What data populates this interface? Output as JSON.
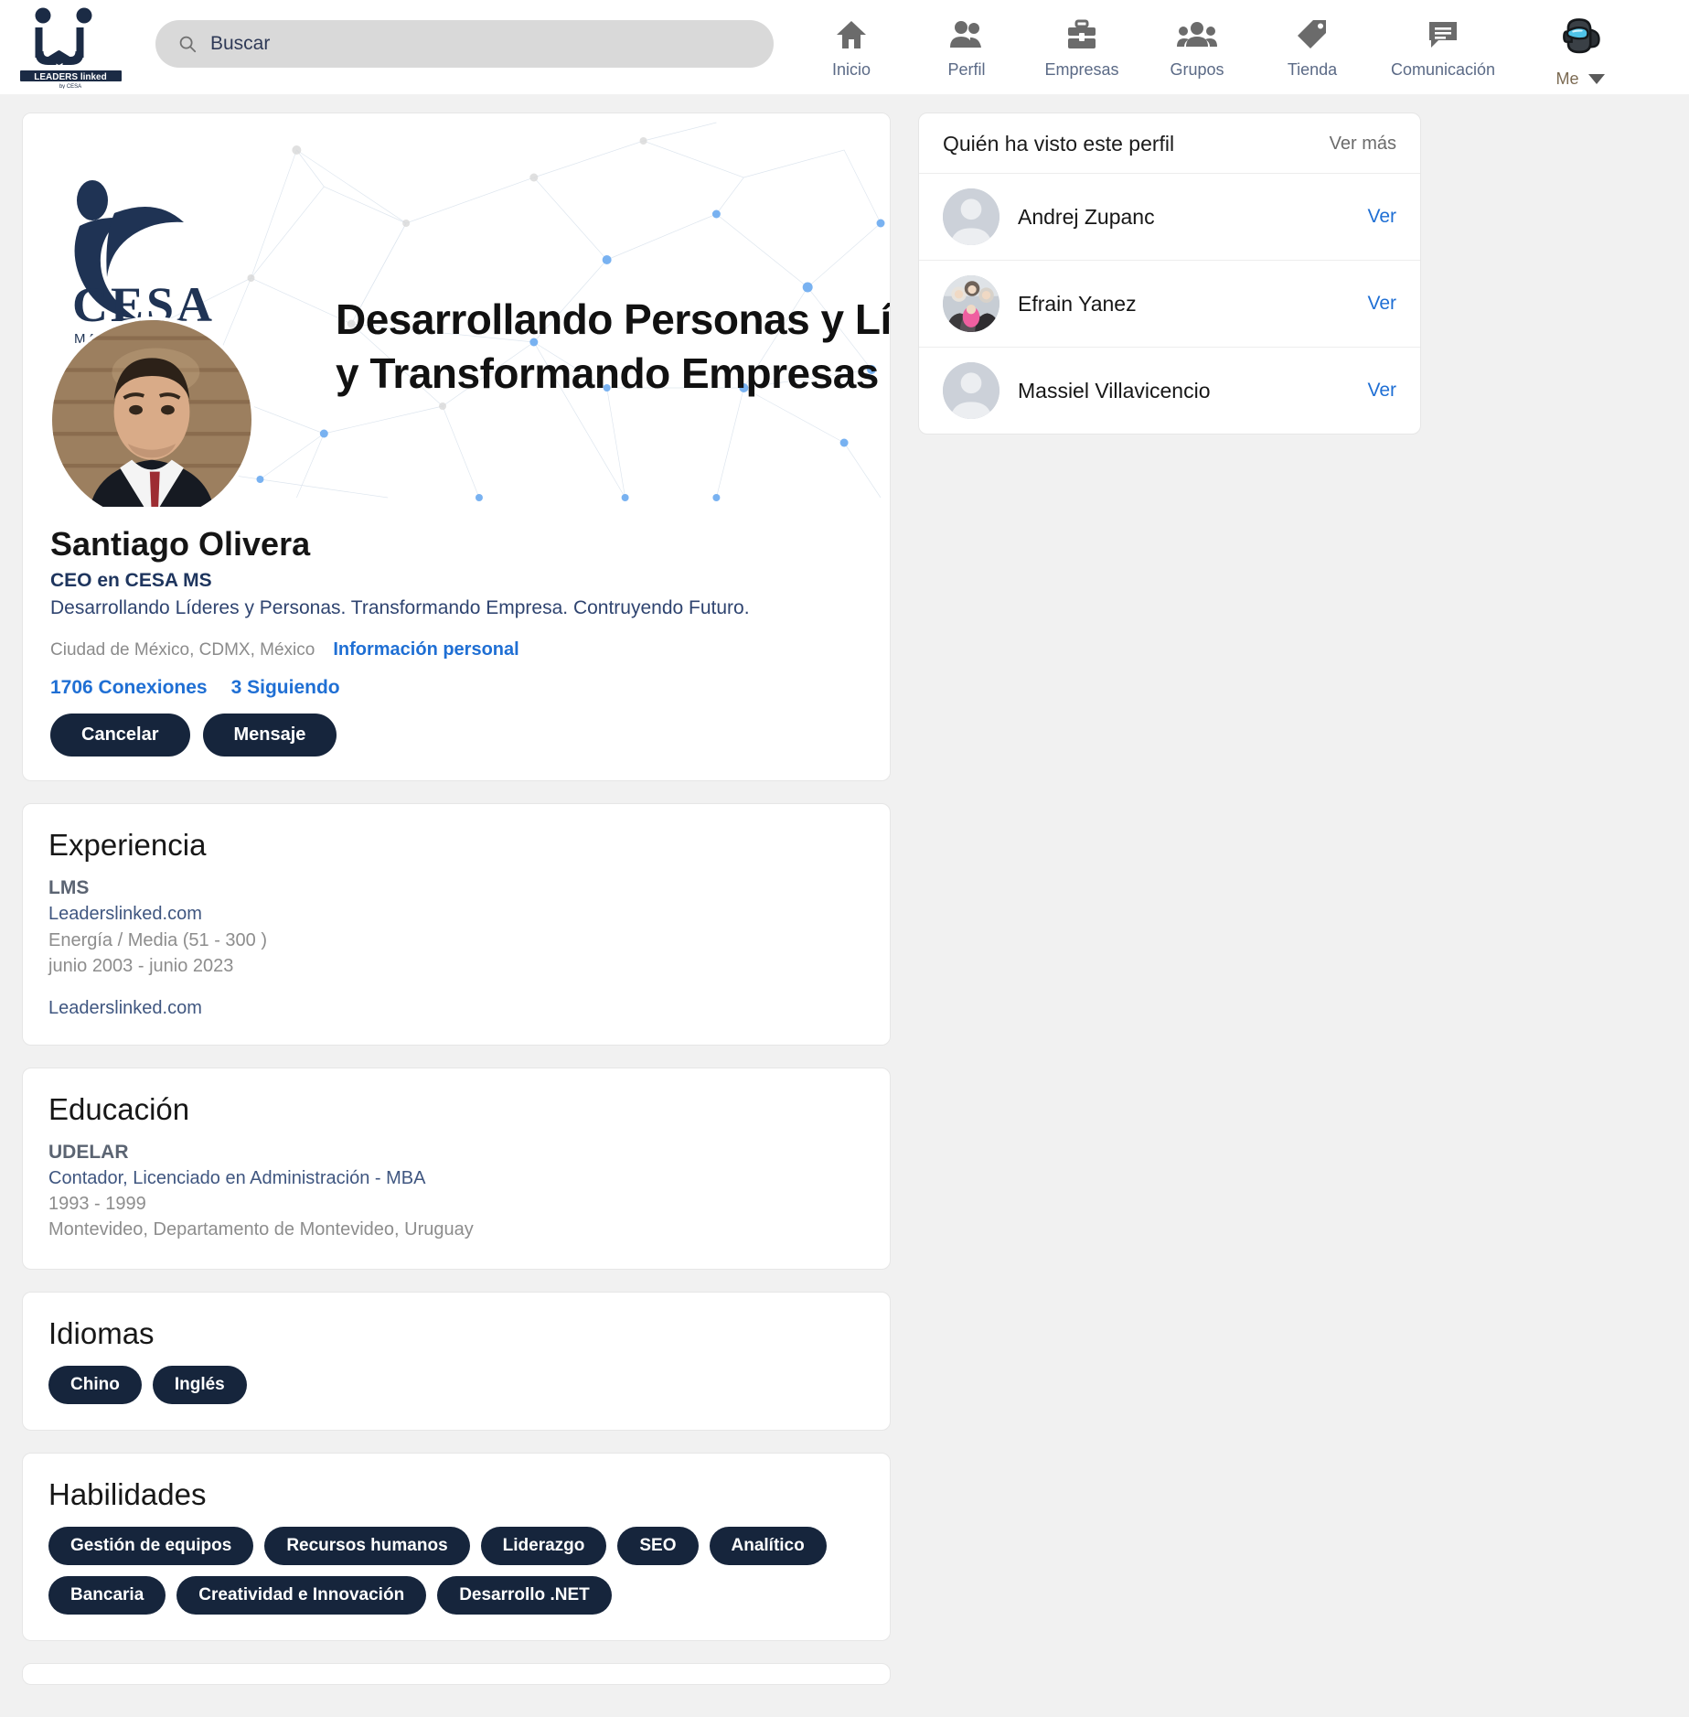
{
  "brand": {
    "logo_title": "LEADERS linked",
    "logo_sub": "by CESA"
  },
  "search": {
    "placeholder": "Buscar",
    "value": ""
  },
  "nav": {
    "items": [
      {
        "label": "Inicio",
        "icon": "home-icon"
      },
      {
        "label": "Perfil",
        "icon": "people-icon"
      },
      {
        "label": "Empresas",
        "icon": "briefcase-icon"
      },
      {
        "label": "Grupos",
        "icon": "group-icon"
      },
      {
        "label": "Tienda",
        "icon": "tag-icon"
      },
      {
        "label": "Comunicación",
        "icon": "chat-icon"
      }
    ],
    "me_label": "Me"
  },
  "profile": {
    "cover_text_line1": "Desarrollando Personas y Líderes",
    "cover_text_line2": "y Transformando Empresas",
    "cover_logo_text": "CESA",
    "name": "Santiago Olivera",
    "headline": "CEO en CESA MS",
    "tagline": "Desarrollando Líderes y Personas. Transformando Empresa. Contruyendo Futuro.",
    "location": "Ciudad de México, CDMX, México",
    "personal_info_link": "Información personal",
    "connections": "1706 Conexiones",
    "following": "3 Siguiendo",
    "cancel_label": "Cancelar",
    "message_label": "Mensaje"
  },
  "experience": {
    "title": "Experiencia",
    "entries": [
      {
        "role": "LMS",
        "company": "Leaderslinked.com",
        "industry": "Energía / Media (51 - 300 )",
        "dates": "junio 2003 - junio 2023",
        "link": "Leaderslinked.com"
      }
    ]
  },
  "education": {
    "title": "Educación",
    "entries": [
      {
        "school": "UDELAR",
        "degree": "Contador, Licenciado en Administración - MBA",
        "dates": "1993 - 1999",
        "location": "Montevideo, Departamento de Montevideo, Uruguay"
      }
    ]
  },
  "languages": {
    "title": "Idiomas",
    "tags": [
      "Chino",
      "Inglés"
    ]
  },
  "skills": {
    "title": "Habilidades",
    "tags": [
      "Gestión de equipos",
      "Recursos humanos",
      "Liderazgo",
      "SEO",
      "Analítico",
      "Bancaria",
      "Creatividad e Innovación",
      "Desarrollo .NET"
    ]
  },
  "viewers": {
    "title": "Quién ha visto este perfil",
    "more_label": "Ver más",
    "items": [
      {
        "name": "Andrej Zupanc",
        "action": "Ver",
        "avatar": "placeholder"
      },
      {
        "name": "Efrain Yanez",
        "action": "Ver",
        "avatar": "photo"
      },
      {
        "name": "Massiel Villavicencio",
        "action": "Ver",
        "avatar": "placeholder"
      }
    ]
  },
  "colors": {
    "brand_navy": "#16253c",
    "link_blue": "#1f6fd4",
    "page_bg": "#f1f1f1",
    "search_bg": "#d9d9d9"
  }
}
